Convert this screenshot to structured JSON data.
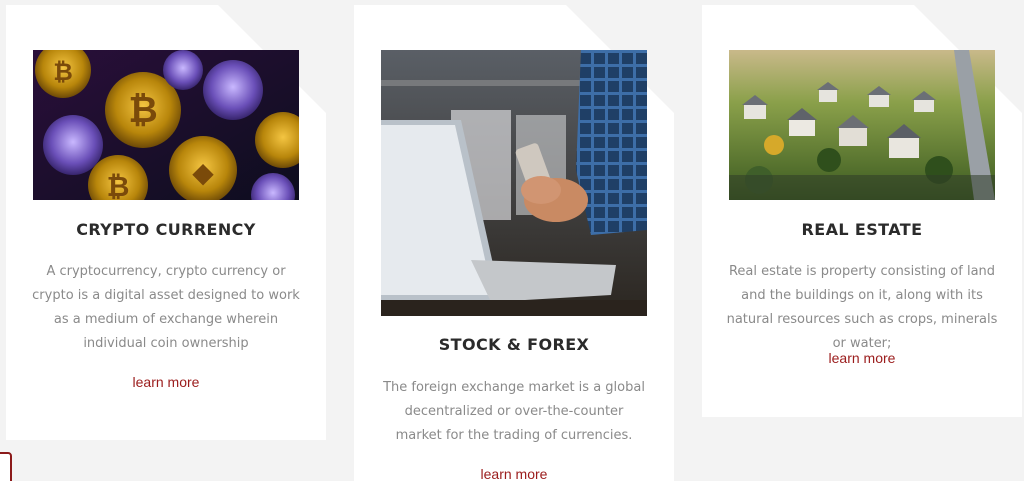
{
  "cards": [
    {
      "title": "CRYPTO CURRENCY",
      "description": "A cryptocurrency, crypto currency or crypto is a digital asset designed to work as a medium of exchange wherein individual coin ownership",
      "link_label": "learn more",
      "image": "crypto-coins-photo"
    },
    {
      "title": "STOCK & FOREX",
      "description": "The foreign exchange market is a global decentralized or over-the-counter market for the trading of currencies.",
      "link_label": "learn more",
      "image": "laptop-phone-trader-photo"
    },
    {
      "title": "REAL ESTATE",
      "description": "Real estate is property consisting of land and the buildings on it, along with its natural resources such as crops, minerals or water;",
      "link_label": "learn more",
      "image": "suburban-houses-aerial-photo"
    }
  ],
  "colors": {
    "page_background": "#f3f3f3",
    "card_background": "#ffffff",
    "link": "#9b1c1c",
    "title": "#2b2b2b",
    "body_text": "#8a8a8a"
  }
}
